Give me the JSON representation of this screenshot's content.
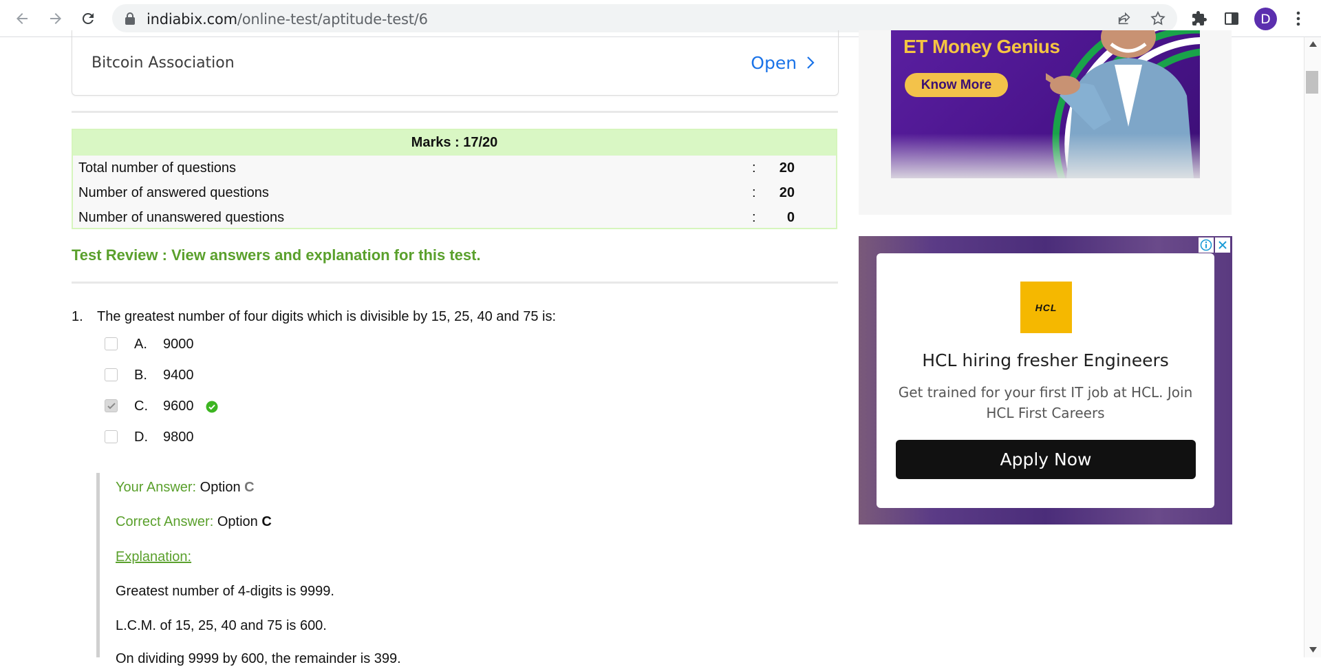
{
  "browser": {
    "url_host": "indiabix.com",
    "url_path": "/online-test/aptitude-test/6",
    "profile_initial": "D"
  },
  "company_box": {
    "name": "Bitcoin Association",
    "open_label": "Open"
  },
  "marks": {
    "title": "Marks : 17/20",
    "rows": [
      {
        "label": "Total number of questions",
        "value": "20"
      },
      {
        "label": "Number of answered questions",
        "value": "20"
      },
      {
        "label": "Number of unanswered questions",
        "value": "0"
      }
    ]
  },
  "review_link": "Test Review : View answers and explanation for this test.",
  "question": {
    "number": "1.",
    "text": "The greatest number of four digits which is divisible by 15, 25, 40 and 75 is:",
    "options": [
      {
        "letter": "A.",
        "text": "9000"
      },
      {
        "letter": "B.",
        "text": "9400"
      },
      {
        "letter": "C.",
        "text": "9600"
      },
      {
        "letter": "D.",
        "text": "9800"
      }
    ],
    "your_answer_label": "Your Answer:",
    "your_answer_text": "Option",
    "your_answer_value": "C",
    "correct_answer_label": "Correct Answer:",
    "correct_answer_text": "Option",
    "correct_answer_value": "C",
    "explanation_label": "Explanation:",
    "explanation_lines": [
      "Greatest number of 4-digits is 9999.",
      "L.C.M. of 15, 25, 40 and 75 is 600.",
      "On dividing 9999 by 600, the remainder is 399."
    ]
  },
  "ad_top": {
    "title": "ET Money Genius",
    "button": "Know More"
  },
  "ad_hcl": {
    "logo_text": "HCL",
    "title": "HCL hiring fresher Engineers",
    "description": "Get trained for your first IT job at HCL. Join HCL First Careers",
    "button": "Apply Now"
  },
  "colors": {
    "accent_green": "#5aa02c",
    "link_blue": "#1a73e8",
    "marks_header_bg": "#d9f7c4"
  }
}
